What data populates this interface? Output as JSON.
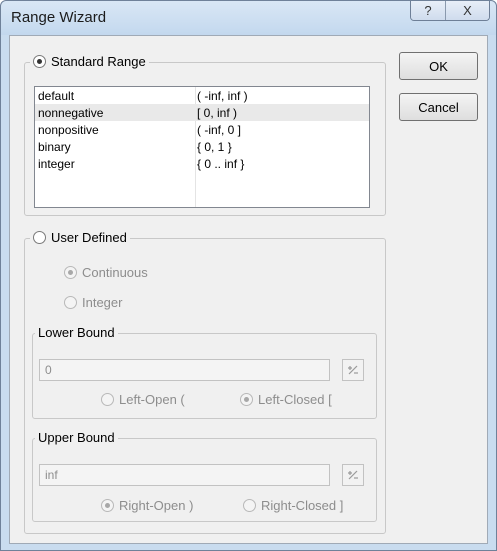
{
  "window": {
    "title": "Range Wizard",
    "help_glyph": "?",
    "close_glyph": "X"
  },
  "buttons": {
    "ok": "OK",
    "cancel": "Cancel"
  },
  "standard": {
    "label": "Standard Range",
    "selected": true,
    "rows": [
      {
        "name": "default",
        "range": "( -inf, inf )"
      },
      {
        "name": "nonnegative",
        "range": "[ 0, inf )"
      },
      {
        "name": "nonpositive",
        "range": "( -inf, 0 ]"
      },
      {
        "name": "binary",
        "range": "{ 0, 1 }"
      },
      {
        "name": "integer",
        "range": "{ 0 .. inf }"
      }
    ],
    "selected_row": 1
  },
  "user_defined": {
    "label": "User Defined",
    "selected": false,
    "continuous_label": "Continuous",
    "integer_label": "Integer",
    "lower": {
      "label": "Lower Bound",
      "value": "0",
      "left_open_label": "Left-Open (",
      "left_closed_label": "Left-Closed ["
    },
    "upper": {
      "label": "Upper Bound",
      "value": "inf",
      "right_open_label": "Right-Open )",
      "right_closed_label": "Right-Closed ]"
    }
  },
  "icons": {
    "picker": "calculator-picker-icon"
  }
}
